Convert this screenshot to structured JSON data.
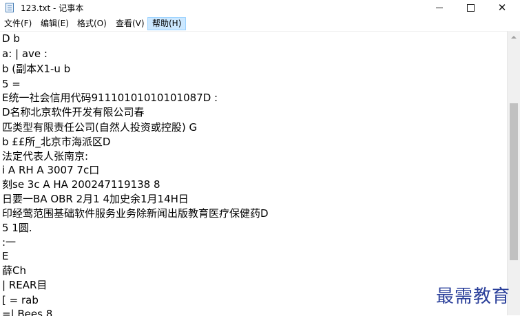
{
  "window": {
    "title": "123.txt - 记事本",
    "icon": "notepad-icon",
    "controls": {
      "minimize": "minimize-icon",
      "maximize": "maximize-icon",
      "close": "✕"
    }
  },
  "menu": {
    "items": [
      {
        "label": "文件(F)"
      },
      {
        "label": "编辑(E)"
      },
      {
        "label": "格式(O)"
      },
      {
        "label": "查看(V)"
      },
      {
        "label": "帮助(H)",
        "active": true
      }
    ]
  },
  "editor": {
    "lines": [
      "D b",
      "a: | ave :",
      "b (副本X1-u b",
      "5 =",
      "E统一社会信用代码91110101010101087D :",
      "D名称北京软件开发有限公司春",
      "匹类型有限责任公司(自然人投资或控股) G",
      "b ££所_北京市海派区D",
      "法定代表人张南京:",
      "i A RH A 3007 7c口",
      "刻se 3c A HA 200247119138 8",
      "日要一BA OBR 2月1 4加史余1月14H日",
      "印经莺范围基础软件服务业务除新闻出版教育医疗保健药D",
      "5 1圆.",
      ":一",
      "E",
      "薛Ch",
      "| REAR目",
      "[ = rab",
      "=| Bees 8"
    ]
  },
  "watermark": {
    "text": "最需教育",
    "color": "#2a3f9a"
  },
  "colors": {
    "menu_active_bg": "#cce8ff",
    "scrollbar_thumb": "#c1c1c1"
  }
}
